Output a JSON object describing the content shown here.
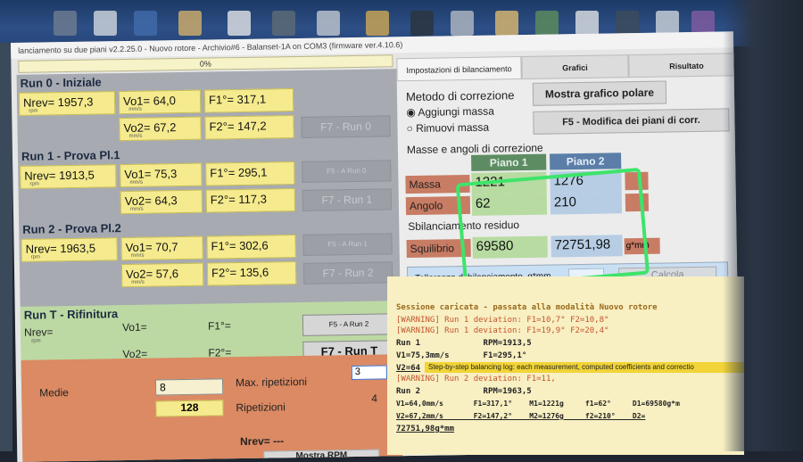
{
  "window": {
    "title": "lanciamento su due piani v2.2.25.0 - Nuovo rotore - Archivio#6 - Balanset-1A on COM3 (firmware ver.4.10.6)",
    "progress": "0%"
  },
  "runs": [
    {
      "title": "Run 0 - Iniziale",
      "nrev": "Nrev= 1957,3",
      "vo1": "Vo1= 64,0",
      "vo2": "Vo2= 67,2",
      "f1": "F1°= 317,1",
      "f2": "F2°= 147,2",
      "unit_rpm": "rpm",
      "unit_mms": "mm/s",
      "button_label": "F7 - Run 0",
      "side_label": ""
    },
    {
      "title": "Run 1 - Prova Pl.1",
      "nrev": "Nrev= 1913,5",
      "vo1": "Vo1= 75,3",
      "vo2": "Vo2= 64,3",
      "f1": "F1°= 295,1",
      "f2": "F2°= 117,3",
      "unit_rpm": "rpm",
      "unit_mms": "mm/s",
      "button_label": "F7 - Run 1",
      "side_label": "F5 - A Run 0"
    },
    {
      "title": "Run 2 - Prova Pl.2",
      "nrev": "Nrev= 1963,5",
      "vo1": "Vo1= 70,7",
      "vo2": "Vo2= 57,6",
      "f1": "F1°= 302,6",
      "f2": "F2°= 135,6",
      "unit_rpm": "rpm",
      "unit_mms": "mm/s",
      "button_label": "F7 - Run 2",
      "side_label": "F5 - A Run 1"
    }
  ],
  "runT": {
    "title": "Run T - Rifinitura",
    "nrev": "Nrev=",
    "vo1": "Vo1=",
    "vo2": "Vo2=",
    "f1": "F1°=",
    "f2": "F2°=",
    "unit_rpm": "rpm",
    "unit_mms": "mm/s",
    "side_label": "F5 - A Run 2",
    "button_label": "F7 - Run T"
  },
  "settings": {
    "medie_label": "Medie",
    "medie_value": "8",
    "medie_count": "128",
    "max_rip_label": "Max. ripetizioni",
    "max_rip_value": "3",
    "ripetizioni_label": "Ripetizioni",
    "ripetizioni_value": "4",
    "nrev_footer": "Nrev= ---",
    "footer_button": "Mostra RPM"
  },
  "tabs": [
    "Impostazioni di bilanciamento",
    "Grafici",
    "Risultato"
  ],
  "correction": {
    "method_label": "Metodo di correzione",
    "option_add": "Aggiungi massa",
    "option_remove": "Rimuovi massa",
    "polar_button": "Mostra grafico polare",
    "modify_button": "F5 - Modifica dei piani di corr.",
    "masses_title": "Masse e angoli di correzione",
    "plane1": "Piano 1",
    "plane2": "Piano 2",
    "row_mass": "Massa",
    "row_angle": "Angolo",
    "mass1": "1221",
    "mass2": "1276",
    "angle1": "62",
    "angle2": "210",
    "residual_title": "Sbilanciamento residuo",
    "residual_label": "Squilibrio",
    "residual1": "69580",
    "residual2": "72751,98",
    "residual_unit": "g*mm",
    "tolerance_label": "Tolleranza di bilanciamento, g*mm",
    "calc_button": "Calcola"
  },
  "log": {
    "lines": [
      "Sessione caricata - passata alla modalità Nuovo rotore",
      "[WARNING] Run 1 deviation: F1=10,7° F2=10,8°",
      "[WARNING] Run 1 deviation: F1=19,9° F2=20,4°",
      "Run 1             RPM=1913,5",
      "V1=75,3mm/s       F1=295,1°",
      "V2=64",
      "[WARNING] Run 2 deviation: F1=11,",
      "Run 2             RPM=1963,5",
      "V1=64,0mm/s       F1=317,1°    M1=1221g     f1=62°     D1=69580g*m",
      "V2=67,2mm/s       F2=147,2°    M2=1276g     f2=210°    D2=",
      "72751,98g*mm"
    ],
    "tooltip": "Step-by-step balancing log: each measurement, computed coefficients and correctio"
  },
  "colors": {
    "yellow_field": "#f5eb8e",
    "grey_panel": "#a7aab1",
    "green_panel": "#bcd9a3",
    "orange_panel": "#db8a63",
    "annotation": "#3ee46a"
  }
}
